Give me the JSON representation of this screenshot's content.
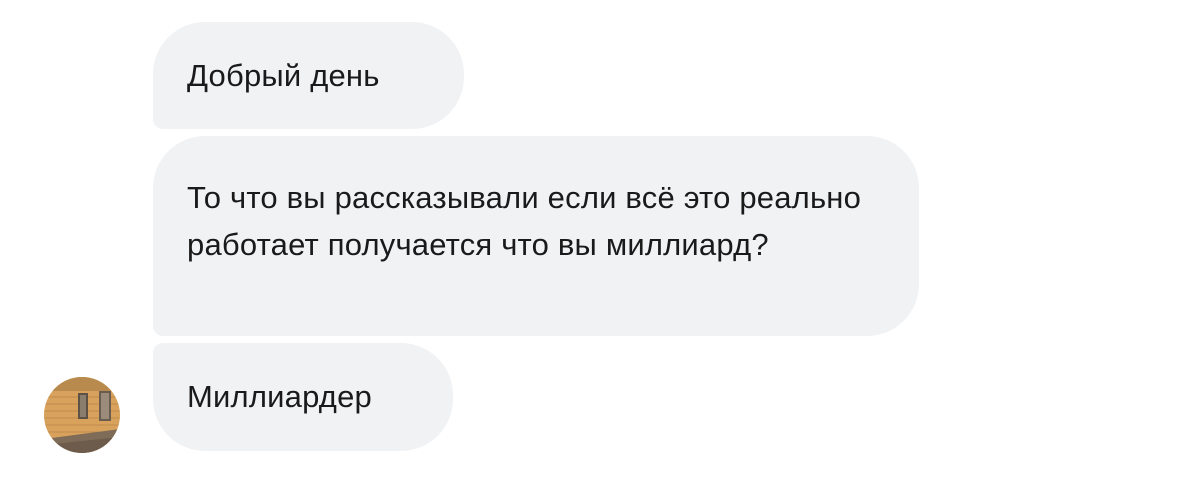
{
  "conversation": {
    "messages": [
      {
        "text": "Добрый день"
      },
      {
        "text": "То что вы рассказывали если всё это реально работает получается что вы миллиард?"
      },
      {
        "text": "Миллиардер"
      }
    ],
    "sender_avatar": {
      "icon": "building-photo-avatar",
      "colors": [
        "#c89a52",
        "#a9804a",
        "#7c6a55"
      ]
    }
  },
  "colors": {
    "bubble": "#f1f2f4",
    "text": "#1a1a1a",
    "background": "#ffffff"
  }
}
